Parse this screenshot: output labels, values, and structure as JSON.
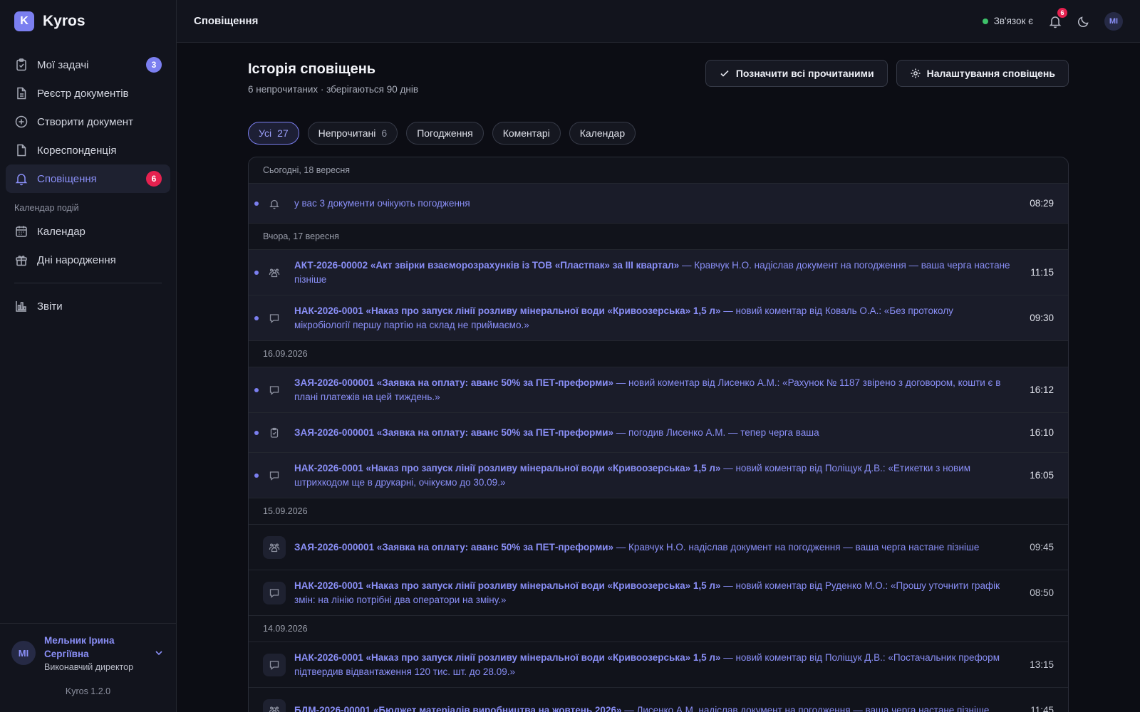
{
  "brand": {
    "logo_letter": "K",
    "name": "Kyros"
  },
  "sidebar": {
    "items": [
      {
        "label": "Мої задачі",
        "icon": "clipboard-check-icon",
        "badge": "3"
      },
      {
        "label": "Реєстр документів",
        "icon": "document-icon"
      },
      {
        "label": "Створити документ",
        "icon": "plus-circle-icon"
      },
      {
        "label": "Кореспонденція",
        "icon": "document-icon"
      },
      {
        "label": "Сповіщення",
        "icon": "bell-icon",
        "badge": "6",
        "active": true
      }
    ],
    "section_label": "Календар подій",
    "calendar_items": [
      {
        "label": "Календар",
        "icon": "calendar-icon"
      },
      {
        "label": "Дні народження",
        "icon": "gift-icon"
      }
    ],
    "reports": {
      "label": "Звіти",
      "icon": "bar-chart-icon"
    }
  },
  "user": {
    "initials": "МІ",
    "name": "Мельник Ірина Сергіївна",
    "role": "Виконавчий директор"
  },
  "version": "Kyros 1.2.0",
  "topbar": {
    "title": "Сповіщення",
    "connection": "Зв'язок є",
    "bell_badge": "6",
    "avatar": "МІ"
  },
  "page": {
    "title": "Історія сповіщень",
    "subtitle": "6 непрочитаних · зберігаються 90 днів",
    "mark_all_label": "Позначити всі прочитаними",
    "settings_label": "Налаштування сповіщень"
  },
  "filters": [
    {
      "label": "Усі",
      "count": "27",
      "active": true
    },
    {
      "label": "Непрочитані",
      "count": "6"
    },
    {
      "label": "Погодження"
    },
    {
      "label": "Коментарі"
    },
    {
      "label": "Календар"
    }
  ],
  "groups": [
    {
      "label": "Сьогодні, 18 вересня",
      "items": [
        {
          "icon": "bell-icon",
          "unread": true,
          "doc": "",
          "text": "у вас 3 документи очікують погодження",
          "time": "08:29"
        }
      ]
    },
    {
      "label": "Вчора, 17 вересня",
      "items": [
        {
          "icon": "users-icon",
          "unread": true,
          "doc": "АКТ-2026-00002 «Акт звірки взаєморозрахунків із ТОВ «Пластпак» за III квартал»",
          "text": " — Кравчук Н.О. надіслав документ на погодження — ваша черга настане пізніше",
          "time": "11:15"
        },
        {
          "icon": "comment-icon",
          "unread": true,
          "doc": "НАК-2026-0001 «Наказ про запуск лінії розливу мінеральної води «Кривоозерська» 1,5 л»",
          "text": " — новий коментар від Коваль О.А.: «Без протоколу мікробіології першу партію на склад не приймаємо.»",
          "time": "09:30"
        }
      ]
    },
    {
      "label": "16.09.2026",
      "items": [
        {
          "icon": "comment-icon",
          "unread": true,
          "doc": "ЗАЯ-2026-000001 «Заявка на оплату: аванс 50% за ПЕТ-преформи»",
          "text": " — новий коментар від Лисенко А.М.: «Рахунок № 1187 звірено з договором, кошти є в плані платежів на цей тиждень.»",
          "time": "16:12"
        },
        {
          "icon": "clipboard-check-icon",
          "unread": true,
          "doc": "ЗАЯ-2026-000001 «Заявка на оплату: аванс 50% за ПЕТ-преформи»",
          "text": " — погодив Лисенко А.М. — тепер черга ваша",
          "time": "16:10"
        },
        {
          "icon": "comment-icon",
          "unread": true,
          "doc": "НАК-2026-0001 «Наказ про запуск лінії розливу мінеральної води «Кривоозерська» 1,5 л»",
          "text": " — новий коментар від Поліщук Д.В.: «Етикетки з новим штрихкодом ще в друкарні, очікуємо до 30.09.»",
          "time": "16:05"
        }
      ]
    },
    {
      "label": "15.09.2026",
      "items": [
        {
          "icon": "users-icon",
          "unread": false,
          "doc": "ЗАЯ-2026-000001 «Заявка на оплату: аванс 50% за ПЕТ-преформи»",
          "text": " — Кравчук Н.О. надіслав документ на погодження — ваша черга настане пізніше",
          "time": "09:45"
        },
        {
          "icon": "comment-icon",
          "unread": false,
          "doc": "НАК-2026-0001 «Наказ про запуск лінії розливу мінеральної води «Кривоозерська» 1,5 л»",
          "text": " — новий коментар від Руденко М.О.: «Прошу уточнити графік змін: на лінію потрібні два оператори на зміну.»",
          "time": "08:50"
        }
      ]
    },
    {
      "label": "14.09.2026",
      "items": [
        {
          "icon": "comment-icon",
          "unread": false,
          "doc": "НАК-2026-0001 «Наказ про запуск лінії розливу мінеральної води «Кривоозерська» 1,5 л»",
          "text": " — новий коментар від Поліщук Д.В.: «Постачальник преформ підтвердив відвантаження 120 тис. шт. до 28.09.»",
          "time": "13:15"
        },
        {
          "icon": "users-icon",
          "unread": false,
          "doc": "БДМ-2026-00001 «Бюджет матеріалів виробництва на жовтень 2026»",
          "text": " — Лисенко А.М. надіслав документ на погодження — ваша черга настане пізніше",
          "time": "11:45"
        }
      ]
    }
  ]
}
